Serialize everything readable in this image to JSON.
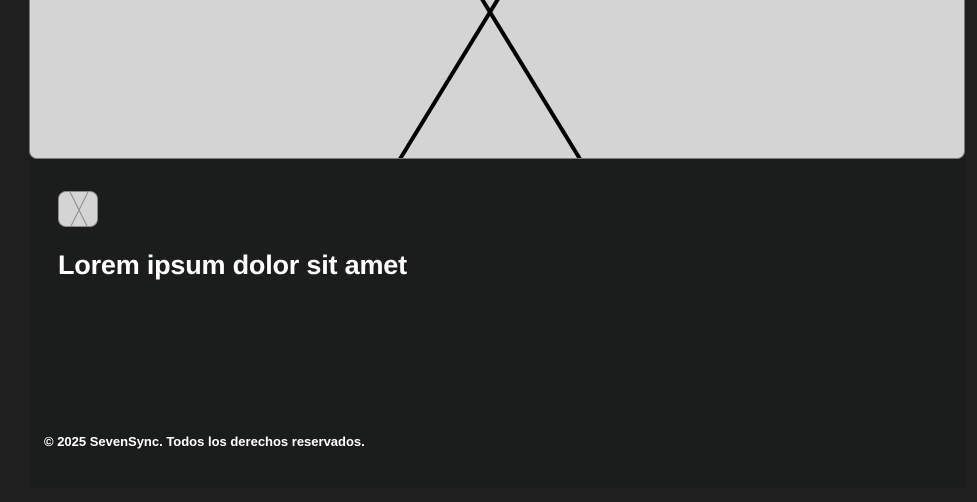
{
  "hero": {
    "image_icon": "image-placeholder-icon"
  },
  "card": {
    "thumb_icon": "image-placeholder-icon",
    "title": "Lorem ipsum dolor sit amet"
  },
  "footer": {
    "copyright": "© 2025 SevenSync. Todos los derechos reservados."
  },
  "colors": {
    "page_background": "#1f1f1f",
    "card_background": "#1b1c1c",
    "placeholder_fill": "#d4d4d4",
    "text": "#ffffff"
  }
}
